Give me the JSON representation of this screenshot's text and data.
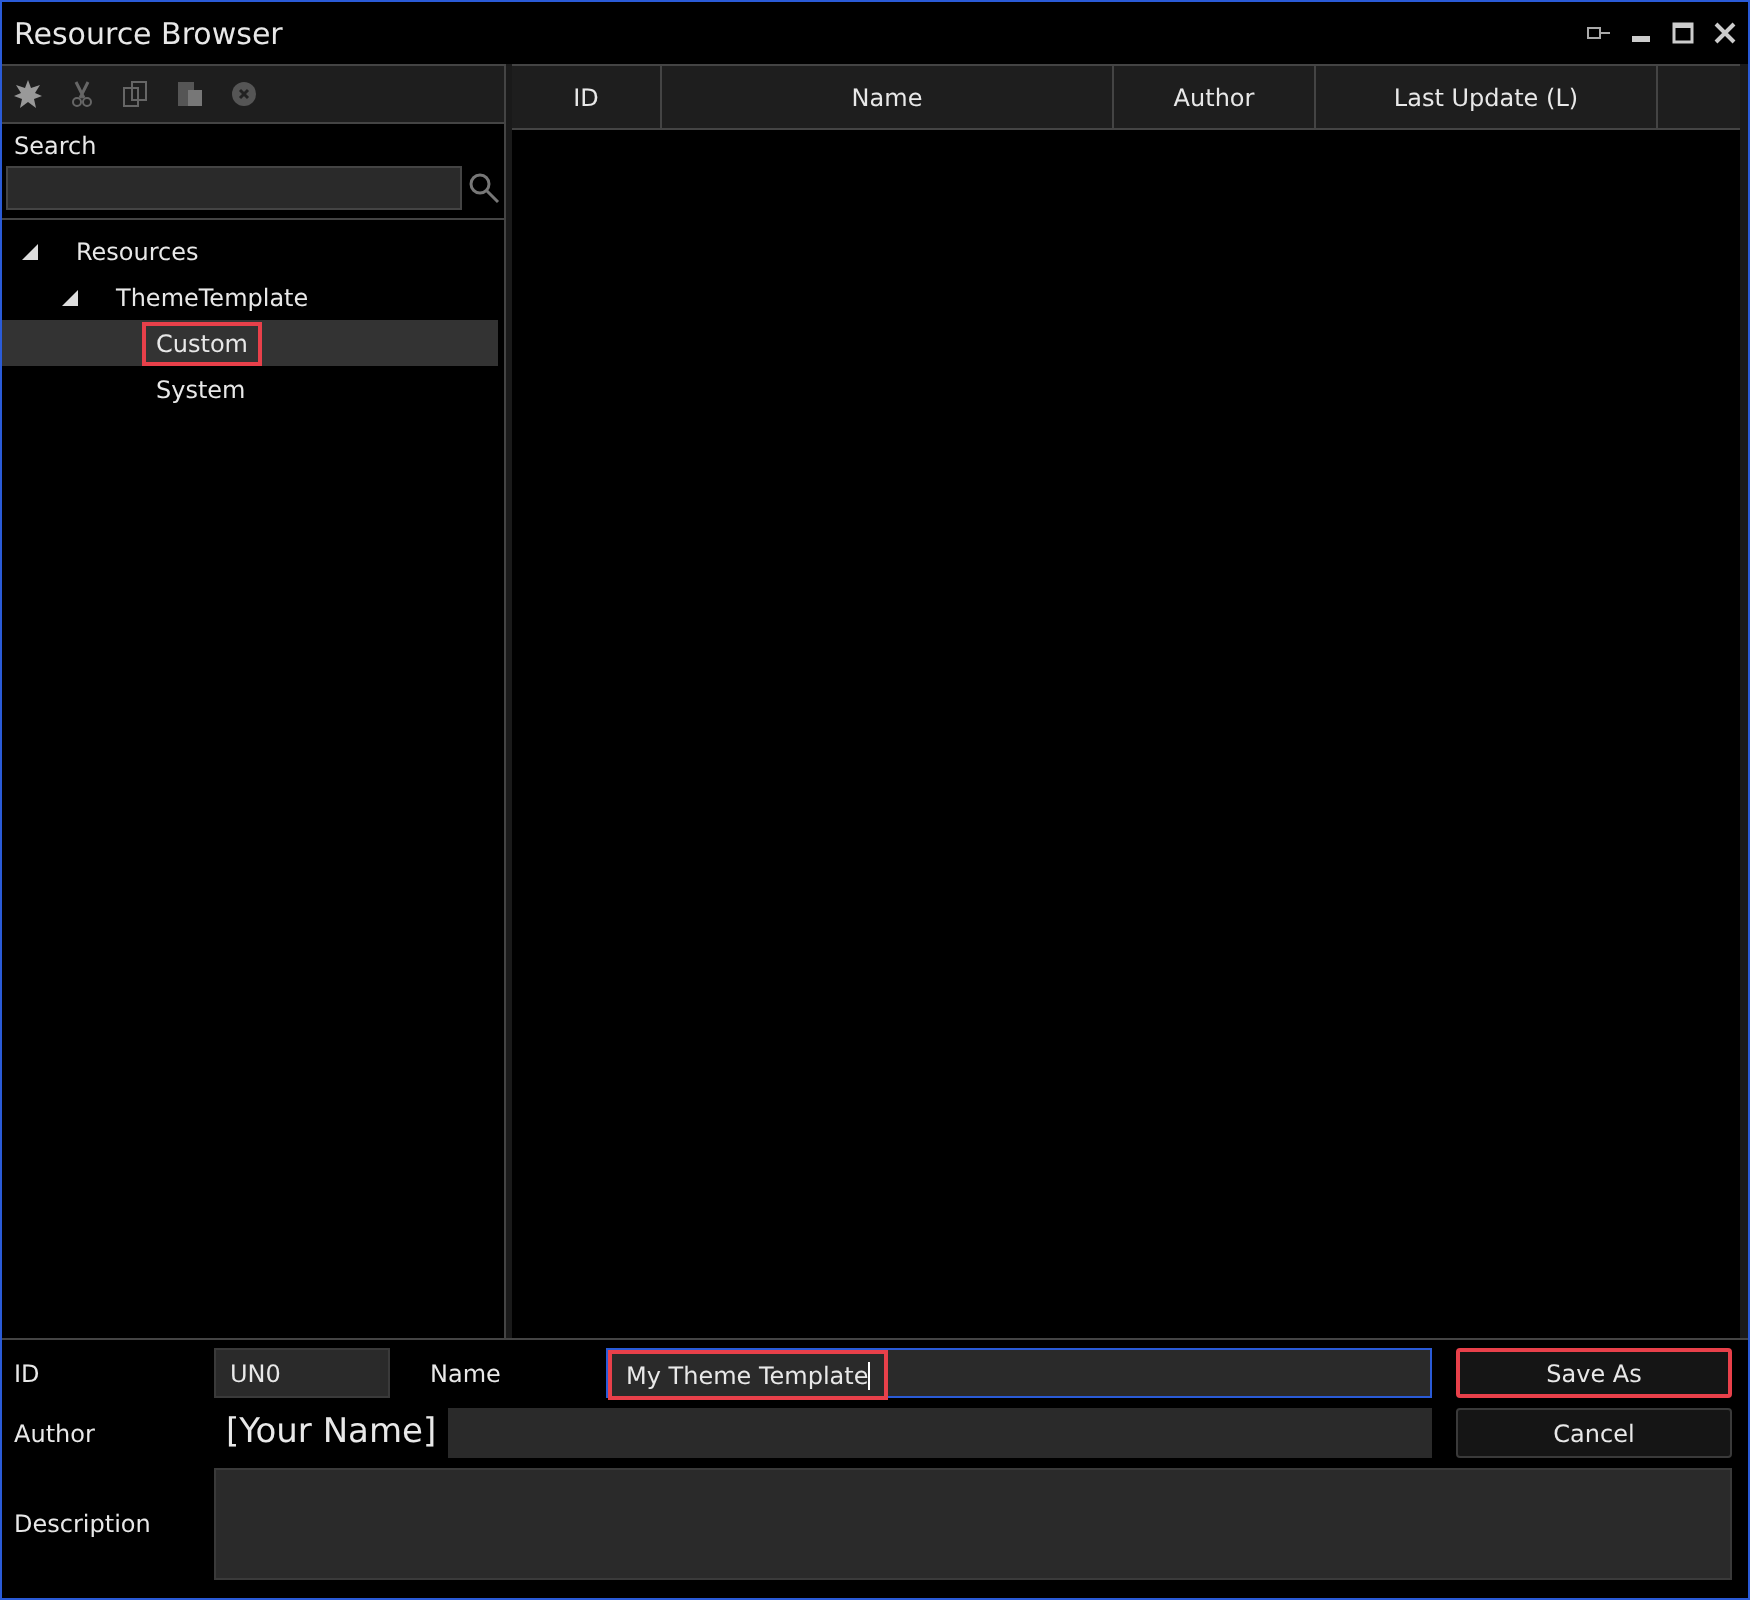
{
  "window": {
    "title": "Resource Browser"
  },
  "search": {
    "label": "Search"
  },
  "tree": [
    {
      "label": "Resources",
      "expanded": true,
      "selected": false,
      "highlighted": false,
      "children": [
        {
          "label": "ThemeTemplate",
          "expanded": true,
          "selected": false,
          "highlighted": false,
          "children": [
            {
              "label": "Custom",
              "selected": true,
              "highlighted": true
            },
            {
              "label": "System",
              "selected": false,
              "highlighted": false
            }
          ]
        }
      ]
    }
  ],
  "table": {
    "columns": [
      "ID",
      "Name",
      "Author",
      "Last Update (L)"
    ]
  },
  "form": {
    "id_label": "ID",
    "id_value": "UN0",
    "name_label": "Name",
    "name_value": "My Theme Template",
    "name_highlighted": true,
    "author_label": "Author",
    "author_value": "[Your Name]",
    "description_label": "Description"
  },
  "buttons": [
    {
      "label": "Save As",
      "highlighted": true
    },
    {
      "label": "Cancel",
      "highlighted": false
    }
  ]
}
